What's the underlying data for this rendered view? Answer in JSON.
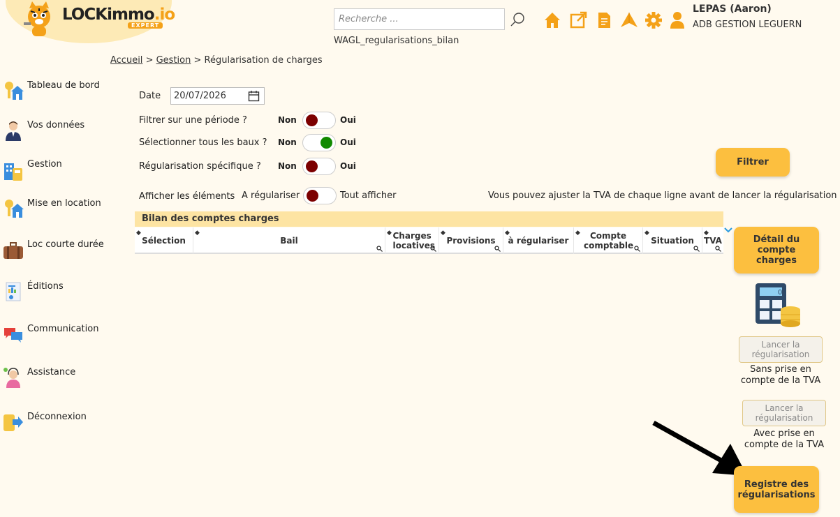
{
  "header": {
    "logo_text": "LOCKimmo",
    "logo_io": ".io",
    "logo_badge": "EXPERT",
    "search_placeholder": "Recherche ...",
    "file_label": "WAGL_regularisations_bilan",
    "user_name": "LEPAS (Aaron)",
    "user_company": "ADB GESTION LEGUERN",
    "icons": [
      "home-icon",
      "external-link-icon",
      "document-icon",
      "paper-plane-icon",
      "gear-icon",
      "user-icon"
    ]
  },
  "breadcrumb": {
    "home": "Accueil",
    "sep1": ">",
    "section": "Gestion",
    "sep2": ">",
    "current": "Régularisation de charges"
  },
  "sidebar": {
    "items": [
      {
        "label": "Tableau de bord",
        "icon": "house-key-icon"
      },
      {
        "label": "Vos données",
        "icon": "person-icon"
      },
      {
        "label": "Gestion",
        "icon": "building-calculator-icon"
      },
      {
        "label": "Mise en location",
        "icon": "house-key-icon"
      },
      {
        "label": "Loc courte durée",
        "icon": "suitcase-icon"
      },
      {
        "label": "Éditions",
        "icon": "report-icon"
      },
      {
        "label": "Communication",
        "icon": "chat-bubbles-icon"
      },
      {
        "label": "Assistance",
        "icon": "support-agent-icon"
      },
      {
        "label": "Déconnexion",
        "icon": "logout-icon"
      }
    ]
  },
  "form": {
    "date_label": "Date",
    "date_value": "20/07/2026",
    "period_label": "Filtrer sur une période ?",
    "all_leases_label": "Sélectionner tous les baux ?",
    "specific_label": "Régularisation spécifique ?",
    "non": "Non",
    "oui": "Oui",
    "period_on": false,
    "all_leases_on": true,
    "specific_on": false,
    "show_label": "Afficher les éléments",
    "show_left": "A régulariser",
    "show_right": "Tout afficher",
    "show_all": false,
    "tva_note": "Vous pouvez ajuster la TVA de chaque ligne avant de lancer la régularisation"
  },
  "buttons": {
    "filter": "Filtrer",
    "detail": "Détail du compte charges",
    "launch_no_tva": "Lancer la régularisation",
    "note_no_tva": "Sans prise en compte de la TVA",
    "launch_tva": "Lancer la régularisation",
    "note_tva": "Avec prise en compte de la TVA",
    "register": "Registre des régularisations"
  },
  "table": {
    "title": "Bilan des comptes charges",
    "columns": [
      "Sélection",
      "Bail",
      "Charges locatives",
      "Provisions",
      "à régulariser",
      "Compte comptable",
      "Situation",
      "TVA"
    ],
    "rows": []
  },
  "colors": {
    "accent": "#fcbf3f",
    "background": "#fffaef",
    "toggle_off": "#7c0000",
    "toggle_on": "#118a00"
  }
}
